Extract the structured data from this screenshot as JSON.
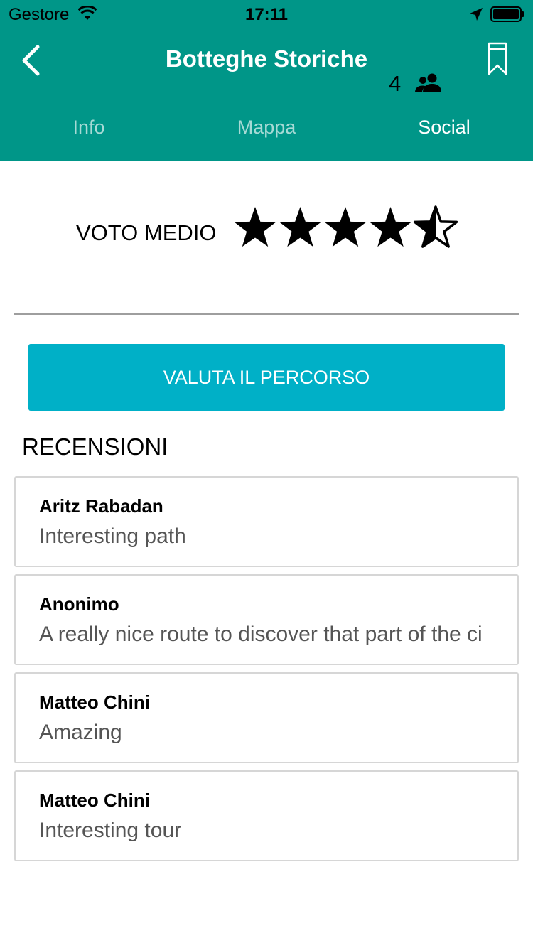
{
  "status_bar": {
    "carrier": "Gestore",
    "time": "17:11"
  },
  "header": {
    "title": "Botteghe Storiche",
    "color": "#009688"
  },
  "tabs": [
    {
      "label": "Info",
      "active": false
    },
    {
      "label": "Mappa",
      "active": false
    },
    {
      "label": "Social",
      "active": true
    }
  ],
  "rating": {
    "label": "VOTO MEDIO",
    "value": 4.5,
    "max": 5,
    "count": "4"
  },
  "actions": {
    "rate_label": "VALUTA IL PERCORSO",
    "rate_color": "#00b0c7"
  },
  "reviews_section": {
    "title": "RECENSIONI",
    "items": [
      {
        "author": "Aritz Rabadan",
        "text": "Interesting path"
      },
      {
        "author": "Anonimo",
        "text": "A really nice route to discover that part of the ci"
      },
      {
        "author": "Matteo Chini",
        "text": "Amazing"
      },
      {
        "author": "Matteo Chini",
        "text": "Interesting tour"
      }
    ]
  }
}
